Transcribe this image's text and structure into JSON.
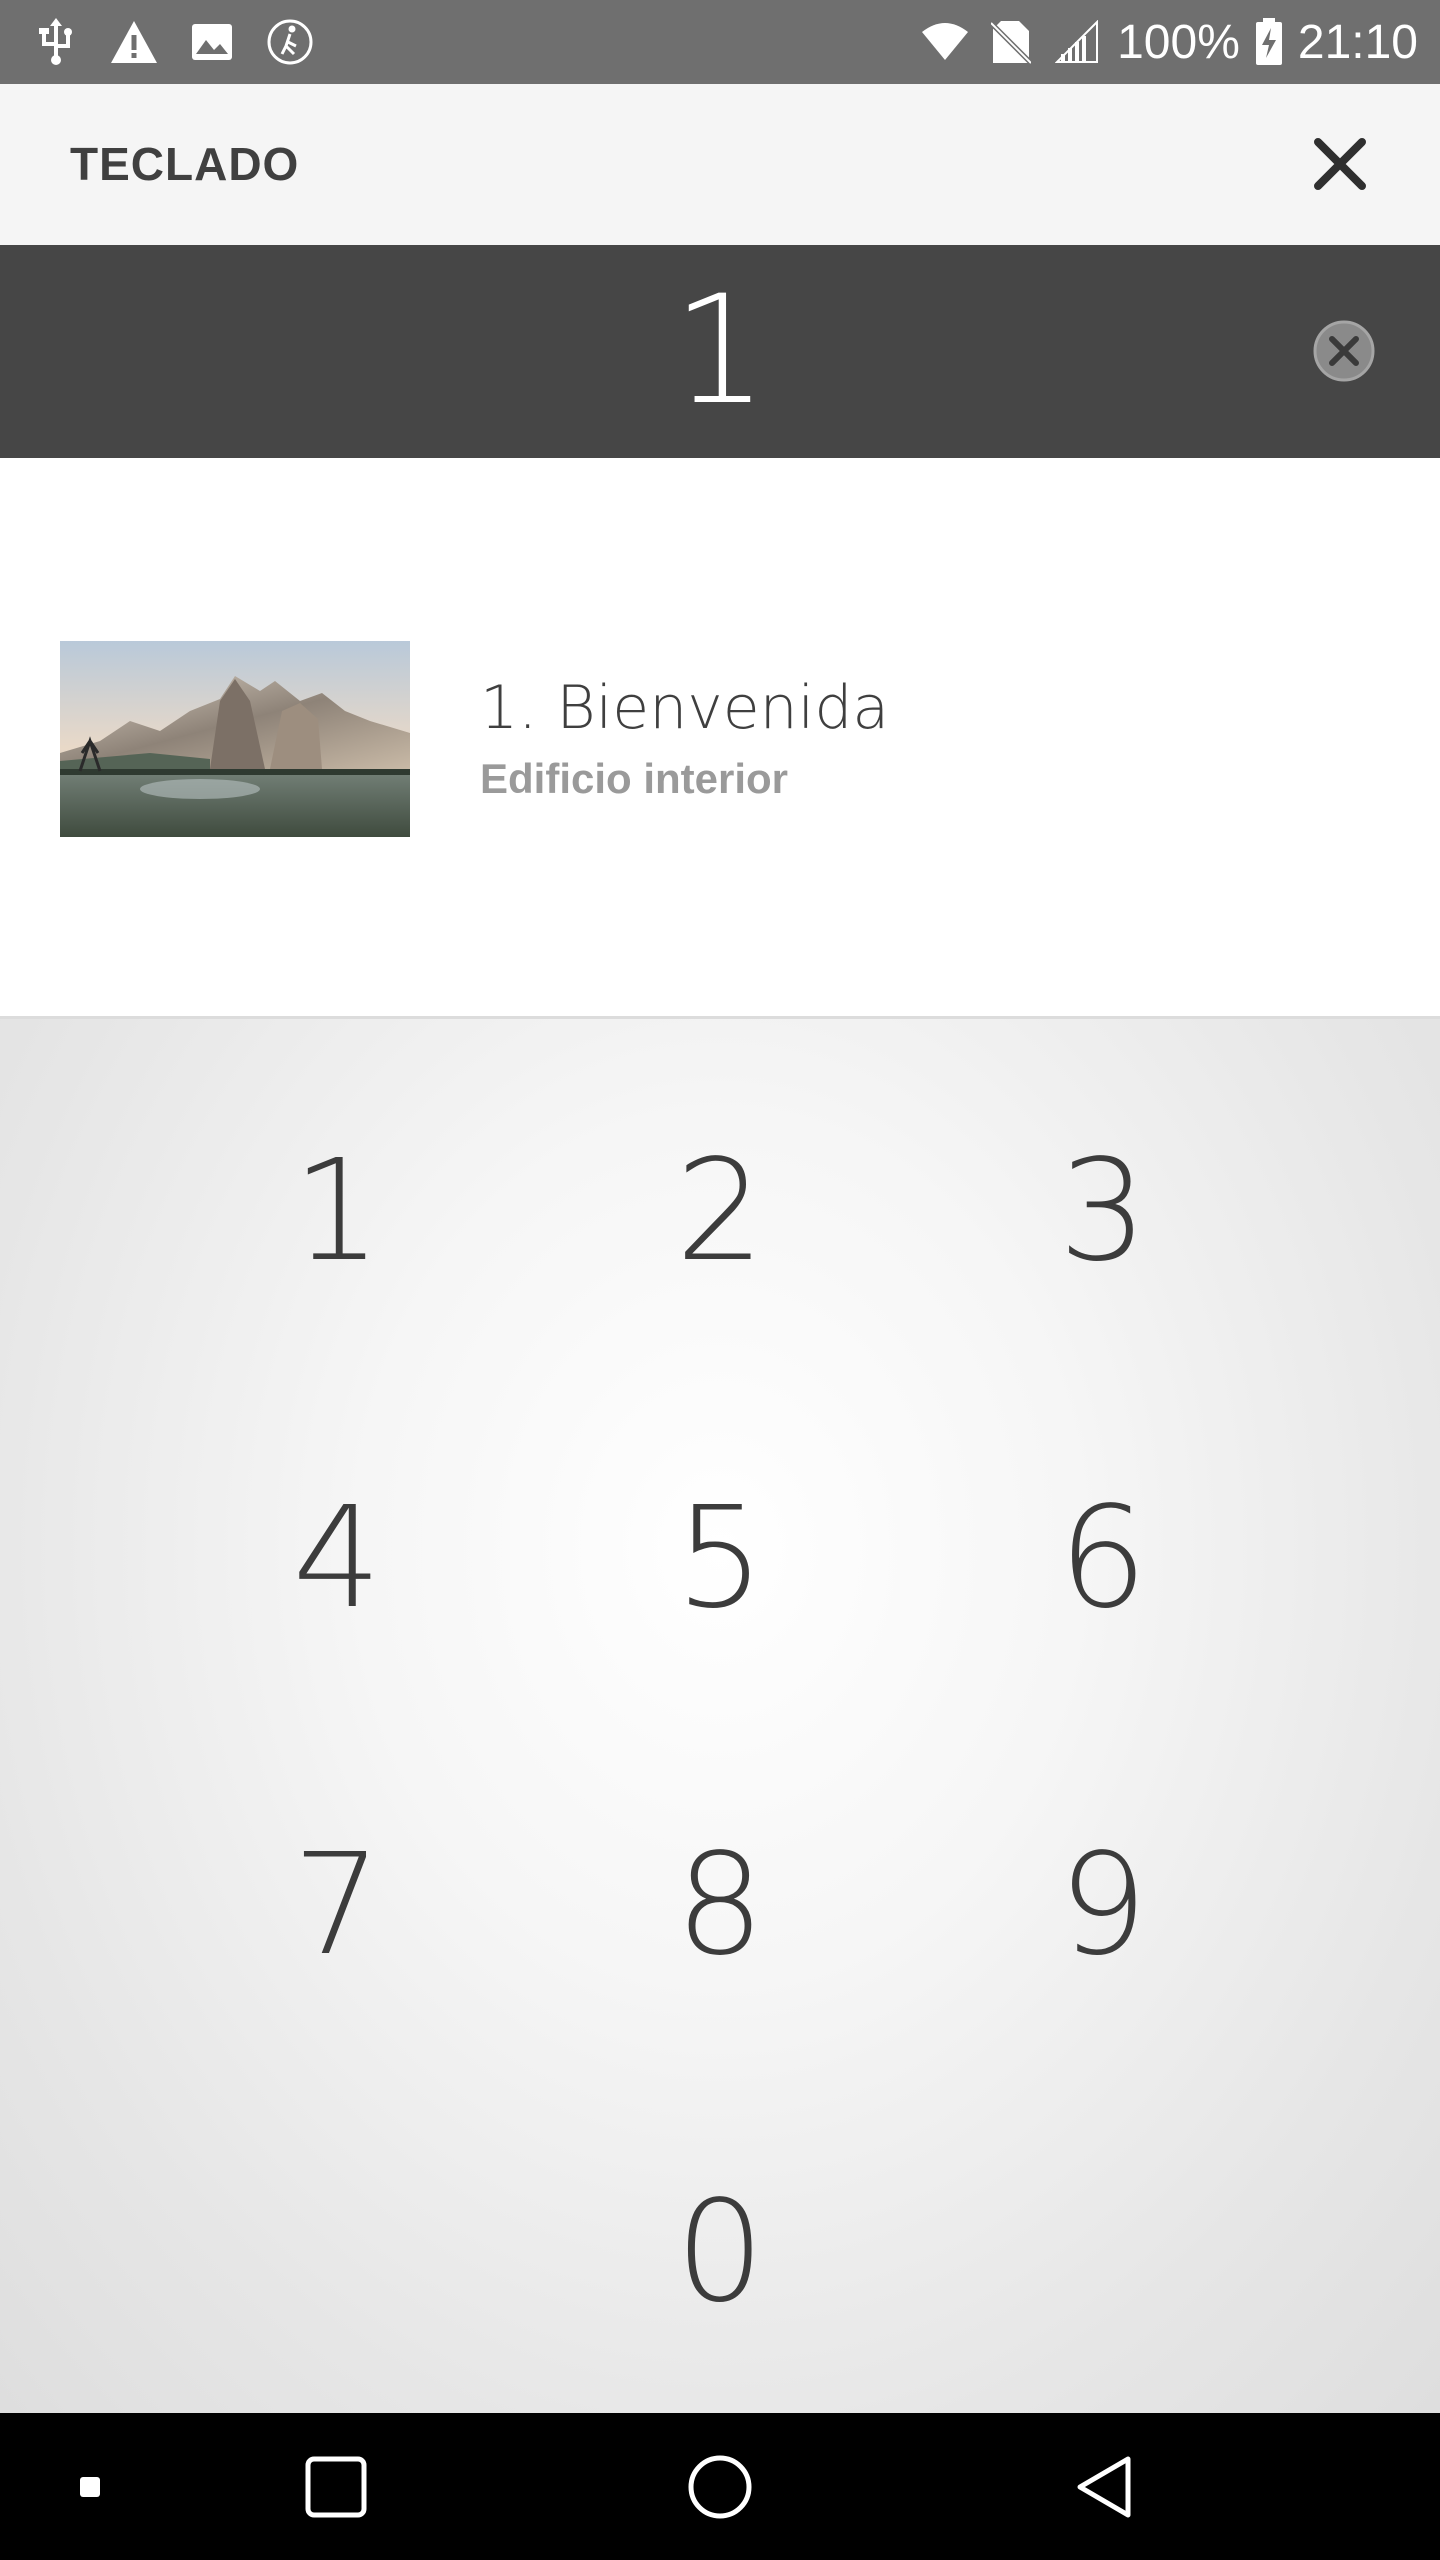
{
  "status_bar": {
    "battery": "100%",
    "time": "21:10",
    "icons_left": [
      "usb-icon",
      "warning-icon",
      "image-icon",
      "walk-icon"
    ],
    "icons_right": [
      "wifi-icon",
      "no-sim-icon",
      "signal-icon",
      "battery-charging-icon"
    ]
  },
  "header": {
    "title": "TECLADO",
    "close_icon": "close-icon"
  },
  "entry": {
    "value": "1",
    "clear_icon": "clear-circle-icon"
  },
  "results": [
    {
      "title": "1. Bienvenida",
      "subtitle": "Edificio interior"
    }
  ],
  "keypad": {
    "keys": [
      "1",
      "2",
      "3",
      "4",
      "5",
      "6",
      "7",
      "8",
      "9",
      "0"
    ]
  },
  "navbar": {
    "icons": [
      "recent-dot-icon",
      "overview-square-icon",
      "home-circle-icon",
      "back-triangle-icon"
    ]
  },
  "colors": {
    "status_bar_bg": "#6f6f6f",
    "header_bg": "#f5f5f5",
    "entry_bg": "#464646",
    "text_dark": "#3f3f3f",
    "text_muted": "#9a9a9a"
  }
}
